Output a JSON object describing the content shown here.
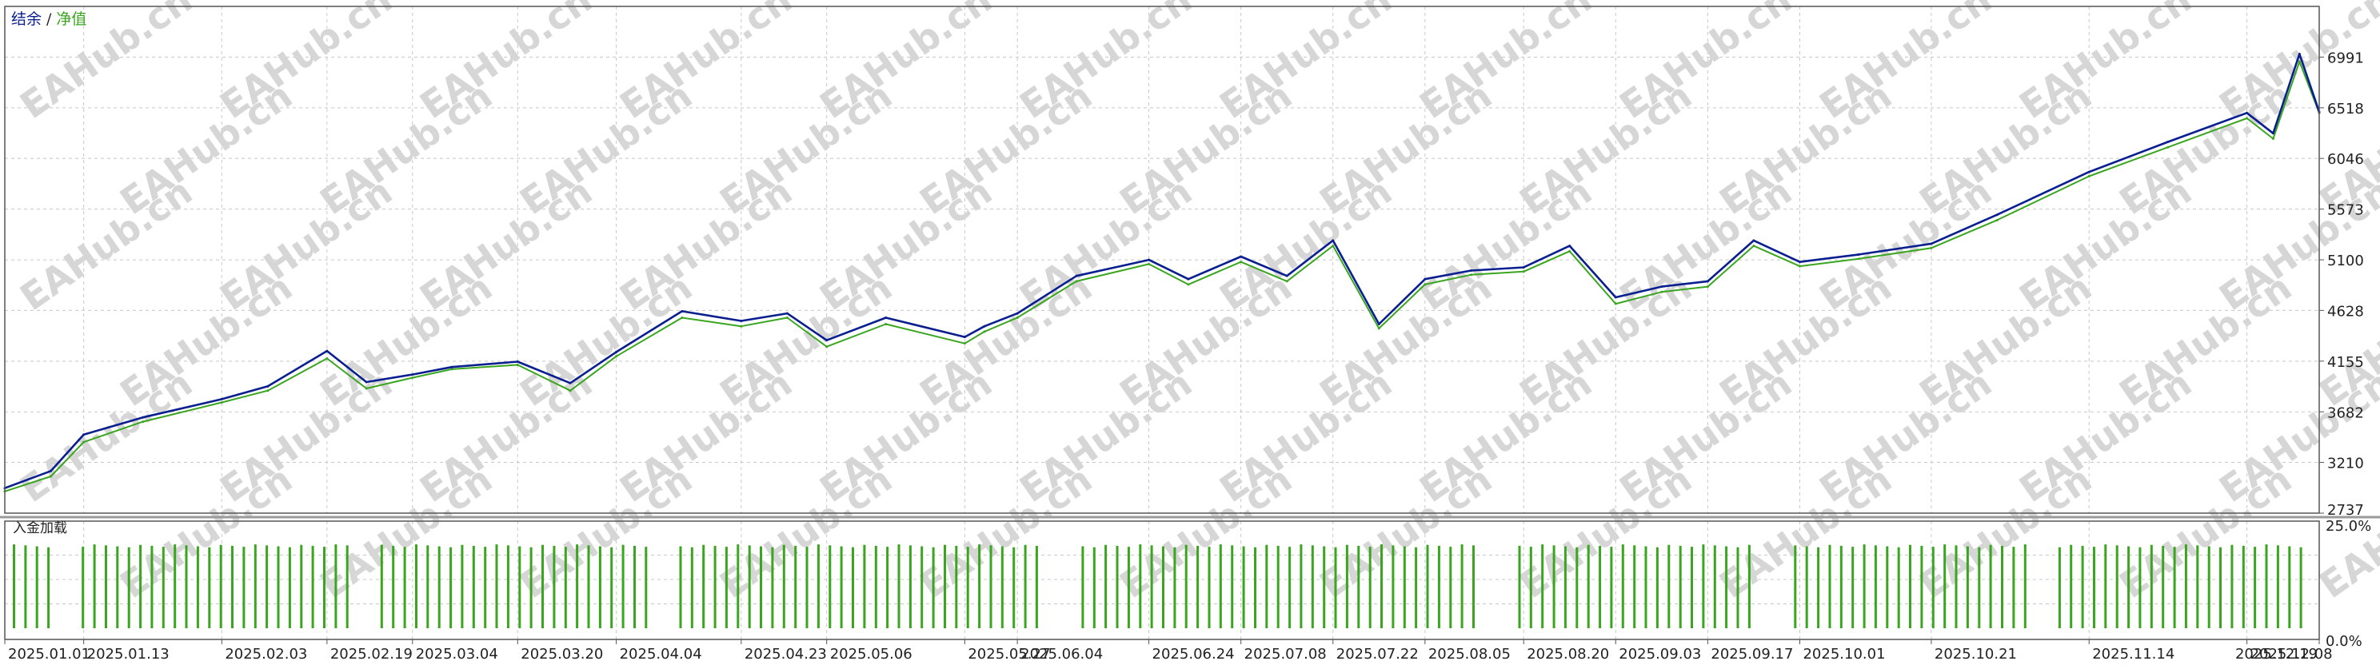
{
  "chart_data": [
    {
      "type": "line",
      "legend": {
        "balance_label": "结余",
        "separator": "/",
        "equity_label": "净值",
        "placement": "top-left"
      },
      "colors": {
        "balance": "#0a1f8f",
        "equity": "#3aa51f",
        "grid": "#c8c8c8",
        "frame": "#555555"
      },
      "grid": true,
      "ylim": [
        2737,
        7464
      ],
      "y_ticks": [
        2737,
        3210,
        3682,
        4155,
        4628,
        5100,
        5573,
        6046,
        6518,
        6991
      ],
      "x_ticks": [
        "2025.01.01",
        "2025.01.13",
        "2025.02.03",
        "2025.02.19",
        "2025.03.04",
        "2025.03.20",
        "2025.04.04",
        "2025.04.23",
        "2025.05.06",
        "2025.05.27",
        "2025.06.04",
        "2025.06.24",
        "2025.07.08",
        "2025.07.22",
        "2025.08.05",
        "2025.08.20",
        "2025.09.03",
        "2025.09.17",
        "2025.10.01",
        "2025.10.21",
        "2025.11.14",
        "2025.12.08",
        "2025.12.19"
      ],
      "series": [
        {
          "name": "结余",
          "x": [
            "2025.01.01",
            "2025.01.08",
            "2025.01.13",
            "2025.01.22",
            "2025.02.03",
            "2025.02.10",
            "2025.02.19",
            "2025.02.25",
            "2025.03.04",
            "2025.03.10",
            "2025.03.20",
            "2025.03.28",
            "2025.04.04",
            "2025.04.14",
            "2025.04.23",
            "2025.04.30",
            "2025.05.06",
            "2025.05.15",
            "2025.05.27",
            "2025.05.30",
            "2025.06.04",
            "2025.06.13",
            "2025.06.24",
            "2025.06.30",
            "2025.07.08",
            "2025.07.15",
            "2025.07.22",
            "2025.07.29",
            "2025.08.05",
            "2025.08.12",
            "2025.08.20",
            "2025.08.27",
            "2025.09.03",
            "2025.09.10",
            "2025.09.17",
            "2025.09.24",
            "2025.10.01",
            "2025.10.10",
            "2025.10.21",
            "2025.10.31",
            "2025.11.14",
            "2025.11.26",
            "2025.12.08",
            "2025.12.12",
            "2025.12.16",
            "2025.12.19"
          ],
          "values": [
            2970,
            3130,
            3470,
            3630,
            3800,
            3920,
            4250,
            3960,
            4030,
            4100,
            4150,
            3950,
            4240,
            4620,
            4530,
            4600,
            4350,
            4560,
            4380,
            4480,
            4600,
            4950,
            5100,
            4920,
            5130,
            4950,
            5280,
            4500,
            4920,
            5000,
            5030,
            5230,
            4750,
            4850,
            4900,
            5280,
            5080,
            5150,
            5250,
            5520,
            5920,
            6200,
            6470,
            6280,
            7020,
            6480
          ]
        },
        {
          "name": "净值",
          "x": [
            "2025.01.01",
            "2025.01.08",
            "2025.01.13",
            "2025.01.22",
            "2025.02.03",
            "2025.02.10",
            "2025.02.19",
            "2025.02.25",
            "2025.03.04",
            "2025.03.10",
            "2025.03.20",
            "2025.03.28",
            "2025.04.04",
            "2025.04.14",
            "2025.04.23",
            "2025.04.30",
            "2025.05.06",
            "2025.05.15",
            "2025.05.27",
            "2025.05.30",
            "2025.06.04",
            "2025.06.13",
            "2025.06.24",
            "2025.06.30",
            "2025.07.08",
            "2025.07.15",
            "2025.07.22",
            "2025.07.29",
            "2025.08.05",
            "2025.08.12",
            "2025.08.20",
            "2025.08.27",
            "2025.09.03",
            "2025.09.10",
            "2025.09.17",
            "2025.09.24",
            "2025.10.01",
            "2025.10.10",
            "2025.10.21",
            "2025.10.31",
            "2025.11.14",
            "2025.11.26",
            "2025.12.08",
            "2025.12.12",
            "2025.12.16",
            "2025.12.19"
          ],
          "values": [
            2940,
            3080,
            3400,
            3590,
            3770,
            3880,
            4180,
            3900,
            4000,
            4080,
            4120,
            3880,
            4200,
            4560,
            4480,
            4560,
            4290,
            4500,
            4320,
            4430,
            4560,
            4900,
            5060,
            4870,
            5080,
            4900,
            5230,
            4460,
            4870,
            4960,
            4990,
            5180,
            4690,
            4800,
            4850,
            5230,
            5040,
            5110,
            5210,
            5470,
            5880,
            6150,
            6420,
            6230,
            6950,
            6470
          ]
        }
      ]
    },
    {
      "type": "bar",
      "title": "入金加载",
      "colors": {
        "bar": "#3aa51f"
      },
      "ylim": [
        0,
        25
      ],
      "y_ticks": [
        "25.0%",
        "0.0%"
      ],
      "bar_count": 200,
      "typical_value": 21.5,
      "gap_ranges": [
        [
          4,
          5
        ],
        [
          30,
          31
        ],
        [
          56,
          57
        ],
        [
          90,
          92
        ],
        [
          128,
          130
        ],
        [
          152,
          154
        ],
        [
          176,
          177
        ]
      ]
    }
  ],
  "watermark": "EAHub.cn"
}
